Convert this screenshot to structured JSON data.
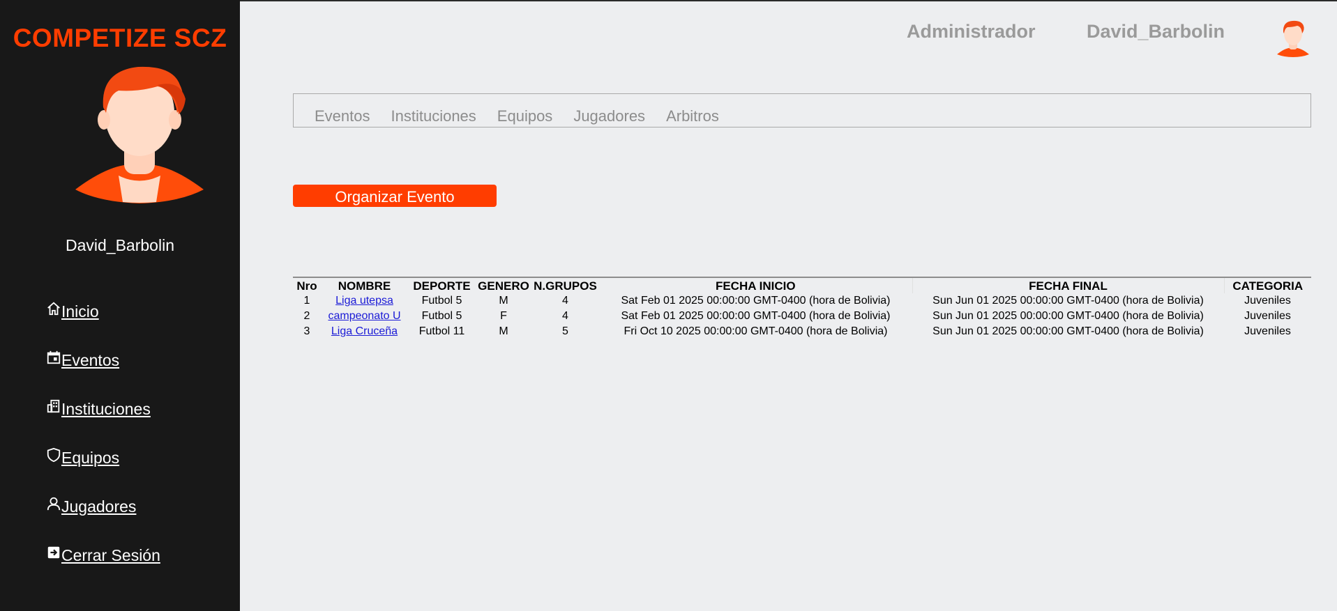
{
  "brand": "COMPETIZE SCZ",
  "sidebar": {
    "username": "David_Barbolin",
    "items": [
      {
        "label": "Inicio",
        "icon": "home-icon"
      },
      {
        "label": "Eventos",
        "icon": "calendar-icon"
      },
      {
        "label": "Instituciones",
        "icon": "building-icon"
      },
      {
        "label": "Equipos",
        "icon": "shield-icon"
      },
      {
        "label": "Jugadores",
        "icon": "user-icon"
      },
      {
        "label": "Cerrar Sesión",
        "icon": "logout-icon"
      }
    ]
  },
  "header": {
    "role": "Administrador",
    "username": "David_Barbolin"
  },
  "tabs": [
    "Eventos",
    "Instituciones",
    "Equipos",
    "Jugadores",
    "Arbitros"
  ],
  "actions": {
    "organize_label": "Organizar Evento"
  },
  "table": {
    "headers": [
      "Nro",
      "NOMBRE",
      "DEPORTE",
      "GENERO",
      "N.GRUPOS",
      "FECHA INICIO",
      "FECHA FINAL",
      "CATEGORIA"
    ],
    "rows": [
      [
        "1",
        "Liga utepsa",
        "Futbol 5",
        "M",
        "4",
        "Sat Feb 01 2025 00:00:00 GMT-0400 (hora de Bolivia)",
        "Sun Jun 01 2025 00:00:00 GMT-0400 (hora de Bolivia)",
        "Juveniles"
      ],
      [
        "2",
        "campeonato U",
        "Futbol 5",
        "F",
        "4",
        "Sat Feb 01 2025 00:00:00 GMT-0400 (hora de Bolivia)",
        "Sun Jun 01 2025 00:00:00 GMT-0400 (hora de Bolivia)",
        "Juveniles"
      ],
      [
        "3",
        "Liga Cruceña",
        "Futbol 11",
        "M",
        "5",
        "Fri Oct 10 2025 00:00:00 GMT-0400 (hora de Bolivia)",
        "Sun Jun 01 2025 00:00:00 GMT-0400 (hora de Bolivia)",
        "Juveniles"
      ]
    ]
  },
  "colors": {
    "accent": "#ff3d00",
    "sidebar_bg": "#181818",
    "page_bg": "#edeef0",
    "link": "#1a1ad6",
    "muted_text": "#9a9a9a"
  }
}
